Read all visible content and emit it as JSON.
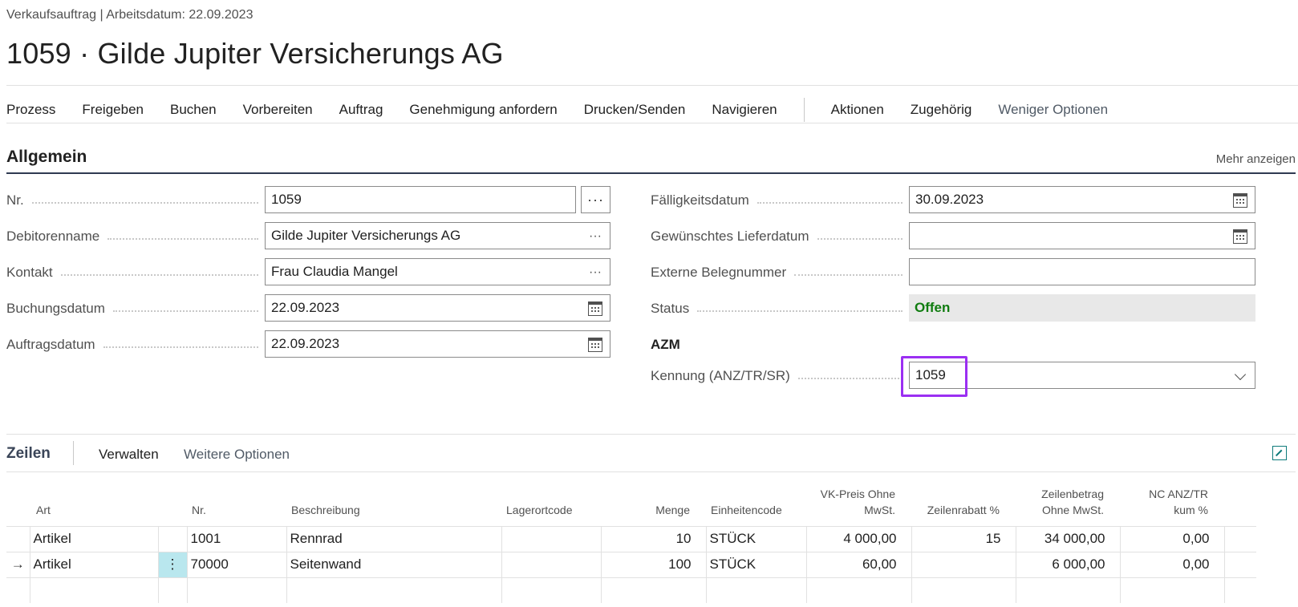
{
  "header": {
    "breadcrumb": "Verkaufsauftrag | Arbeitsdatum: 22.09.2023",
    "title": "1059 · Gilde Jupiter Versicherungs AG"
  },
  "actions": {
    "prozess": "Prozess",
    "freigeben": "Freigeben",
    "buchen": "Buchen",
    "vorbereiten": "Vorbereiten",
    "auftrag": "Auftrag",
    "genehmigung": "Genehmigung anfordern",
    "drucken": "Drucken/Senden",
    "navigieren": "Navigieren",
    "aktionen": "Aktionen",
    "zugehoerig": "Zugehörig",
    "weniger": "Weniger Optionen"
  },
  "general": {
    "title": "Allgemein",
    "more": "Mehr anzeigen",
    "nr_label": "Nr.",
    "nr_value": "1059",
    "debitor_label": "Debitorenname",
    "debitor_value": "Gilde Jupiter Versicherungs AG",
    "kontakt_label": "Kontakt",
    "kontakt_value": "Frau Claudia Mangel",
    "buchungsdatum_label": "Buchungsdatum",
    "buchungsdatum_value": "22.09.2023",
    "auftragsdatum_label": "Auftragsdatum",
    "auftragsdatum_value": "22.09.2023",
    "faelligkeit_label": "Fälligkeitsdatum",
    "faelligkeit_value": "30.09.2023",
    "lieferdatum_label": "Gewünschtes Lieferdatum",
    "lieferdatum_value": "",
    "extern_label": "Externe Belegnummer",
    "extern_value": "",
    "status_label": "Status",
    "status_value": "Offen",
    "group_azm": "AZM",
    "kennung_label": "Kennung (ANZ/TR/SR)",
    "kennung_value": "1059"
  },
  "lines": {
    "title": "Zeilen",
    "verwalten": "Verwalten",
    "weitere": "Weitere Optionen",
    "columns": {
      "art": "Art",
      "nr": "Nr.",
      "beschreibung": "Beschreibung",
      "lagerort": "Lagerortcode",
      "menge": "Menge",
      "einheit": "Einheitencode",
      "vkpreis_1": "VK-Preis Ohne",
      "vkpreis_2": "MwSt.",
      "rabatt": "Zeilenrabatt %",
      "betrag_1": "Zeilenbetrag",
      "betrag_2": "Ohne MwSt.",
      "nc_1": "NC ANZ/TR",
      "nc_2": "kum %"
    },
    "rows": [
      {
        "marker": "",
        "art": "Artikel",
        "nr": "1001",
        "beschreibung": "Rennrad",
        "lagerort": "",
        "menge": "10",
        "einheit": "STÜCK",
        "vkpreis": "4 000,00",
        "rabatt": "15",
        "betrag": "34 000,00",
        "nc": "0,00"
      },
      {
        "marker": "→",
        "art": "Artikel",
        "nr": "70000",
        "beschreibung": "Seitenwand",
        "lagerort": "",
        "menge": "100",
        "einheit": "STÜCK",
        "vkpreis": "60,00",
        "rabatt": "",
        "betrag": "6 000,00",
        "nc": "0,00"
      }
    ]
  },
  "colors": {
    "status_green": "#107c10",
    "highlight_purple": "#9b2ff2",
    "active_cell": "#b9e7ee"
  }
}
